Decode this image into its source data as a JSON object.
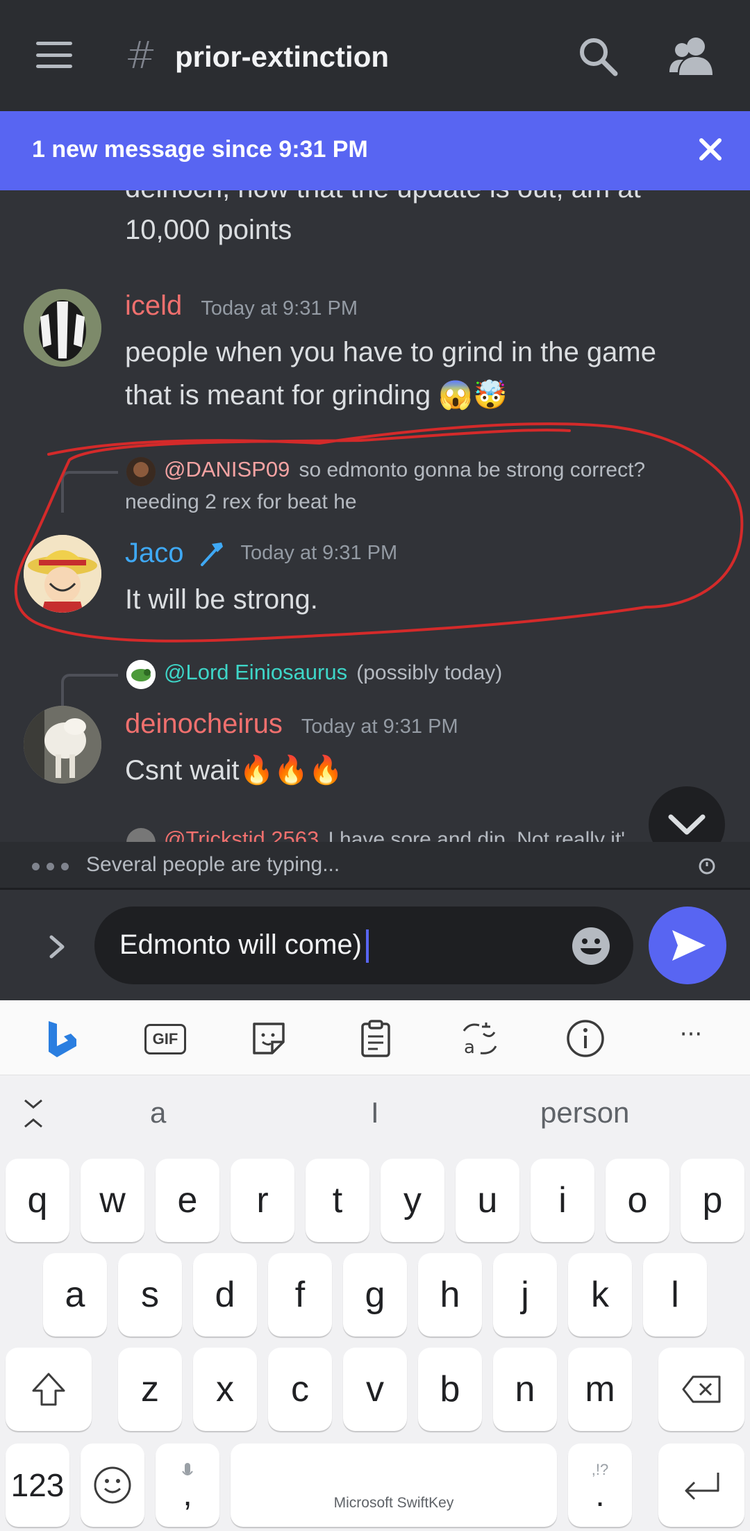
{
  "header": {
    "hash": "#",
    "channel_name": "prior-extinction"
  },
  "banner": {
    "text": "1 new message since 9:31 PM"
  },
  "messages": {
    "partial_cut_line": "deinoch, now that the update is out, am at",
    "partial_line": "10,000 points",
    "m1": {
      "author": "iceld",
      "author_color": "#f0706e",
      "time": "Today at 9:31 PM",
      "line1": "people when you have to grind in the game",
      "line2": "that is meant for grinding 😱🤯"
    },
    "m2": {
      "reply_to": "@DANISP09",
      "reply_to_color": "#f5a3a3",
      "reply_text_1": "so edmonto gonna be strong correct?",
      "reply_text_2": "needing 2 rex for beat he",
      "author": "Jaco",
      "author_color": "#3fa9f5",
      "badge": "hammer-icon",
      "time": "Today at 9:31 PM",
      "text": "It will be strong."
    },
    "m3": {
      "reply_to": "@Lord Einiosaurus",
      "reply_to_color": "#3ed6c8",
      "reply_text": "(possibly today)",
      "author": "deinocheirus",
      "author_color": "#f0706e",
      "time": "Today at 9:31 PM",
      "text": "Csnt wait🔥🔥🔥"
    },
    "m4_partial": {
      "reply_to": "@Trickstid 2563",
      "reply_text": "I have sore and dip. Not really it'"
    }
  },
  "typing": {
    "text": "Several people are typing..."
  },
  "composer": {
    "value": "Edmonto will come)"
  },
  "keyboard": {
    "toolbar": [
      "bing-icon",
      "gif-icon",
      "sticker-icon",
      "clipboard-icon",
      "translate-icon",
      "info-icon",
      "more-icon"
    ],
    "gif_label": "GIF",
    "more_label": "···",
    "suggestions": [
      "a",
      "I",
      "person"
    ],
    "row1": [
      "q",
      "w",
      "e",
      "r",
      "t",
      "y",
      "u",
      "i",
      "o",
      "p"
    ],
    "row2": [
      "a",
      "s",
      "d",
      "f",
      "g",
      "h",
      "j",
      "k",
      "l"
    ],
    "row3": [
      "z",
      "x",
      "c",
      "v",
      "b",
      "n",
      "m"
    ],
    "numbers_key": "123",
    "comma_key": ",",
    "period_key": ".",
    "punct_hint": ",!?",
    "space_label": "Microsoft SwiftKey"
  },
  "colors": {
    "accent": "#5865f2",
    "annotation": "#d42a2a"
  }
}
